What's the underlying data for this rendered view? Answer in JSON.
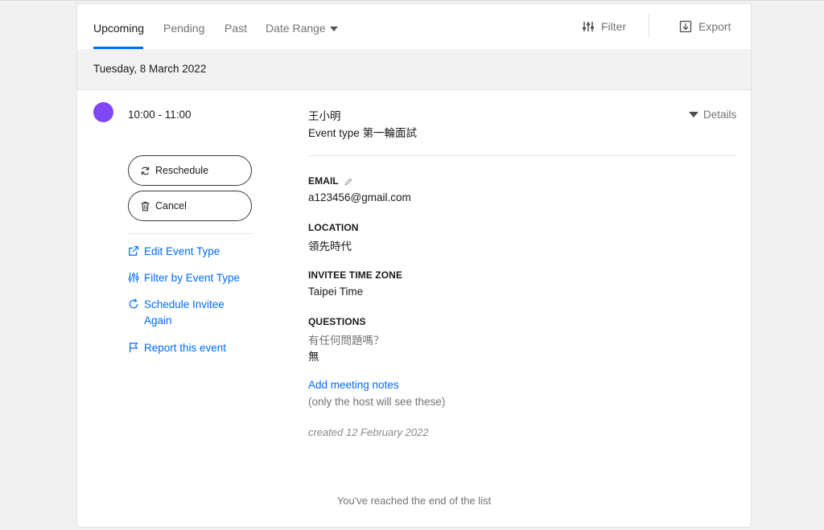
{
  "tabs": [
    {
      "label": "Upcoming",
      "active": true
    },
    {
      "label": "Pending",
      "active": false
    },
    {
      "label": "Past",
      "active": false
    },
    {
      "label": "Date Range",
      "active": false
    }
  ],
  "toolbar": {
    "filter_label": "Filter",
    "export_label": "Export"
  },
  "date_header": "Tuesday, 8 March 2022",
  "event": {
    "color": "#8247f5",
    "time": "10:00 - 11:00",
    "invitee_name": "王小明",
    "event_type_prefix": "Event type",
    "event_type_name": "第一輪面試",
    "details_label": "Details",
    "buttons": {
      "reschedule": "Reschedule",
      "cancel": "Cancel"
    },
    "links": {
      "edit_event_type": "Edit Event Type",
      "filter_by_event_type": "Filter by Event Type",
      "schedule_again_line1": "Schedule Invitee",
      "schedule_again_line2": "Again",
      "report": "Report this event"
    },
    "fields": {
      "email_label": "EMAIL",
      "email_value": "a123456@gmail.com",
      "location_label": "LOCATION",
      "location_value": "領先時代",
      "timezone_label": "INVITEE TIME ZONE",
      "timezone_value": "Taipei Time",
      "questions_label": "QUESTIONS",
      "question_text": "有任何問題嗎？",
      "question_answer": "無"
    },
    "notes_link": "Add meeting notes",
    "notes_hint": "(only the host will see these)",
    "created": "created 12 February 2022"
  },
  "end_message": "You've reached the end of the list",
  "colors": {
    "accent": "#006bff",
    "event_dot": "#8247f5"
  }
}
